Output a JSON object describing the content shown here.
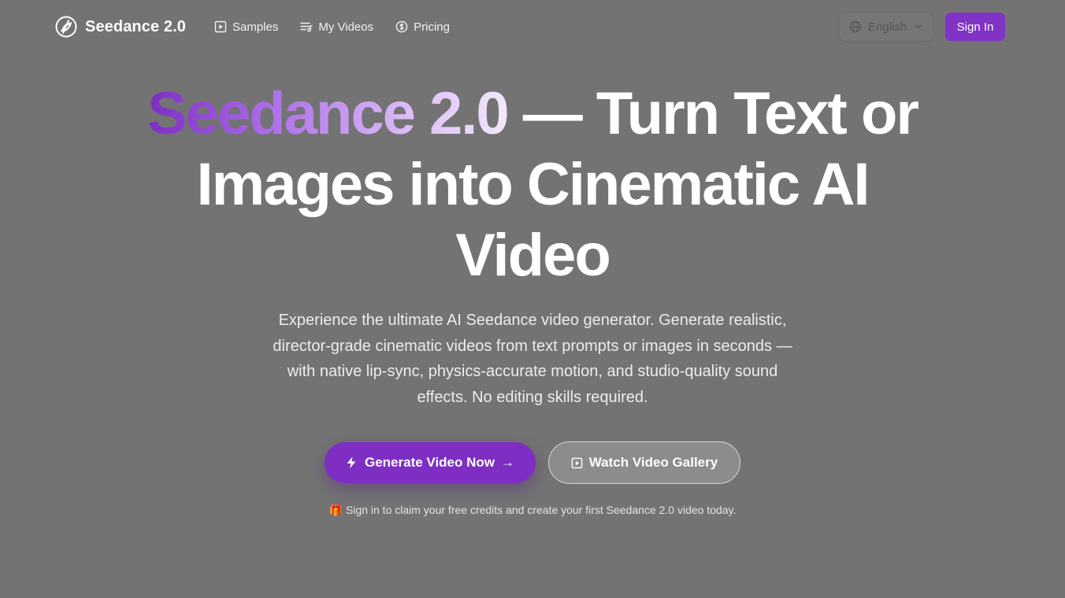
{
  "brand": {
    "name": "Seedance 2.0",
    "logo_icon": "seedance-logo-icon"
  },
  "nav": {
    "links": [
      {
        "label": "Samples",
        "icon": "play-square-icon"
      },
      {
        "label": "My Videos",
        "icon": "playlist-icon"
      },
      {
        "label": "Pricing",
        "icon": "dollar-circle-icon"
      }
    ],
    "language": {
      "selected": "English",
      "icon": "globe-icon"
    },
    "signin_label": "Sign In"
  },
  "hero": {
    "title_highlight": "Seedance 2.0",
    "title_rest": " — Turn Text or Images into Cinematic AI Video",
    "subtitle": "Experience the ultimate AI Seedance video generator. Generate realistic, director-grade cinematic videos from text prompts or images in seconds — with native lip-sync, physics-accurate motion, and studio-quality sound effects. No editing skills required.",
    "primary_cta": "Generate Video Now",
    "primary_arrow": "→",
    "secondary_cta": "Watch Video Gallery",
    "note_emoji": "🎁",
    "note": "Sign in to claim your free credits and create your first Seedance 2.0 video today."
  },
  "colors": {
    "background": "#737373",
    "accent": "#7e2ec2",
    "gradient_start": "#7a2ec2",
    "gradient_end": "#f3e9fd"
  }
}
